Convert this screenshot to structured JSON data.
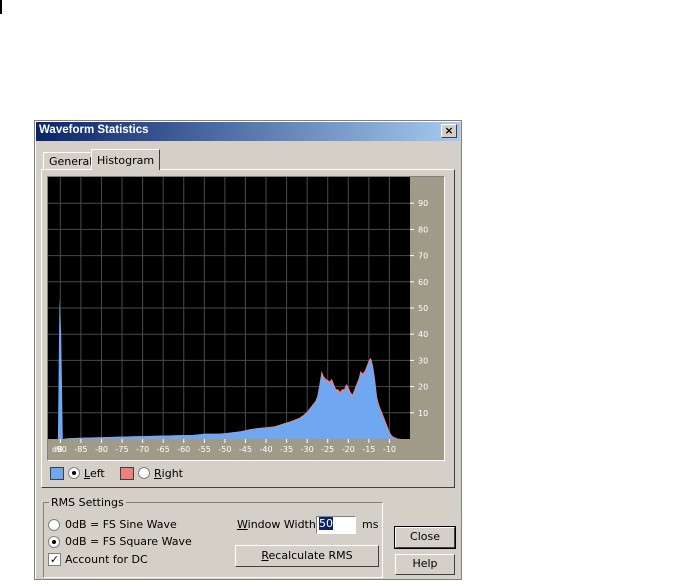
{
  "window": {
    "title": "Waveform Statistics",
    "close_glyph": "×"
  },
  "tabs": [
    {
      "label": "General",
      "active": false
    },
    {
      "label": "Histogram",
      "active": true
    }
  ],
  "legend": {
    "left": {
      "label": "Left",
      "accel": "L",
      "selected": true,
      "color": "#6fa8f0"
    },
    "right": {
      "label": "Right",
      "accel": "R",
      "selected": false,
      "color": "#f08080"
    }
  },
  "rms": {
    "group_title": "RMS Settings",
    "sine_label": "0dB = FS Sine Wave",
    "square_label": "0dB = FS Square Wave",
    "selected": "square",
    "dc_label": "Account for DC",
    "dc_checked": true,
    "window_width_label": "Window Width:",
    "window_width_value": "50",
    "window_width_unit": "ms",
    "recalc_label": "Recalculate RMS"
  },
  "buttons": {
    "close": "Close",
    "help": "Help"
  },
  "chart_data": {
    "type": "area",
    "x_tick_labels": [
      "dB",
      "-90",
      "-85",
      "-80",
      "-75",
      "-70",
      "-65",
      "-60",
      "-55",
      "-50",
      "-45",
      "-40",
      "-35",
      "-30",
      "-25",
      "-20",
      "-15",
      "-10"
    ],
    "y_tick_labels": [
      "10",
      "20",
      "30",
      "40",
      "50",
      "60",
      "70",
      "80",
      "90"
    ],
    "xlim": [
      -93,
      -5
    ],
    "ylim": [
      0,
      100
    ],
    "grid": true,
    "colors": {
      "background": "#000000",
      "grid": "#4a4a4a",
      "axis_panel": "#a09a88",
      "left": "#6fa8f0",
      "right": "#f08080"
    },
    "series": [
      {
        "name": "Left",
        "x": [
          -93,
          -91,
          -90.6,
          -90.2,
          -89.8,
          -89.4,
          -88,
          -85,
          -80,
          -75,
          -70,
          -65,
          -60,
          -58,
          -55,
          -52,
          -50,
          -48,
          -46,
          -44,
          -42,
          -40,
          -38,
          -37,
          -36,
          -35,
          -34,
          -33,
          -32,
          -31,
          -30,
          -29,
          -28.5,
          -28,
          -27.5,
          -27,
          -26.5,
          -26,
          -25.5,
          -25,
          -24.5,
          -24,
          -23.5,
          -23,
          -22.5,
          -22,
          -21.5,
          -21,
          -20.5,
          -20,
          -19.5,
          -19,
          -18.5,
          -18,
          -17.5,
          -17,
          -16.5,
          -16,
          -15.5,
          -15,
          -14.5,
          -14,
          -13.5,
          -13,
          -12.5,
          -12,
          -11.5,
          -11,
          -10.5,
          -10,
          -9.5,
          -9,
          -8,
          -7
        ],
        "values": [
          0,
          0,
          0,
          54,
          40,
          0,
          0.3,
          0.5,
          0.7,
          0.9,
          1.1,
          1.3,
          1.5,
          1.5,
          2,
          2,
          2.2,
          2.6,
          2.8,
          3.5,
          4,
          4.2,
          4.5,
          5,
          5.5,
          6,
          6.4,
          7,
          7.5,
          8.5,
          10,
          12,
          13,
          14,
          16,
          20,
          25,
          23,
          22,
          22,
          21,
          22,
          20,
          18,
          18,
          17,
          18,
          18,
          20,
          19,
          17,
          16,
          18,
          20,
          22,
          25,
          24,
          25,
          27,
          29,
          30,
          27,
          22,
          15,
          12,
          10,
          8,
          6,
          4,
          2,
          1,
          0.5,
          0,
          0
        ]
      },
      {
        "name": "Right",
        "x": [
          -93,
          -91,
          -90.6,
          -90.2,
          -89.8,
          -89.4,
          -88,
          -85,
          -80,
          -75,
          -70,
          -65,
          -60,
          -58,
          -55,
          -52,
          -50,
          -48,
          -46,
          -44,
          -42,
          -40,
          -38,
          -37,
          -36,
          -35,
          -34,
          -33,
          -32,
          -31,
          -30,
          -29,
          -28.5,
          -28,
          -27.5,
          -27,
          -26.5,
          -26,
          -25.5,
          -25,
          -24.5,
          -24,
          -23.5,
          -23,
          -22.5,
          -22,
          -21.5,
          -21,
          -20.5,
          -20,
          -19.5,
          -19,
          -18.5,
          -18,
          -17.5,
          -17,
          -16.5,
          -16,
          -15.5,
          -15,
          -14.5,
          -14,
          -13.5,
          -13,
          -12.5,
          -12,
          -11.5,
          -11,
          -10.5,
          -10,
          -9.5,
          -9,
          -8,
          -7
        ],
        "values": [
          0,
          0,
          0,
          0,
          0,
          0,
          0.3,
          0.5,
          0.7,
          0.9,
          1.1,
          1.3,
          1.5,
          1.5,
          2,
          2,
          2.2,
          2.6,
          3,
          3.7,
          4.2,
          4.5,
          4.8,
          5.3,
          5.8,
          6.3,
          6.8,
          7.4,
          8,
          9,
          10.5,
          12.5,
          13.5,
          14.5,
          16.5,
          21,
          26,
          24,
          23,
          22.5,
          22,
          23,
          21,
          19,
          19,
          18,
          19,
          19,
          21,
          20,
          18,
          17,
          19,
          21,
          23,
          26,
          25,
          26,
          28,
          30,
          31,
          28,
          23,
          16,
          13,
          11,
          9,
          7,
          5,
          3,
          1.5,
          0.8,
          0.2,
          0
        ]
      }
    ]
  }
}
